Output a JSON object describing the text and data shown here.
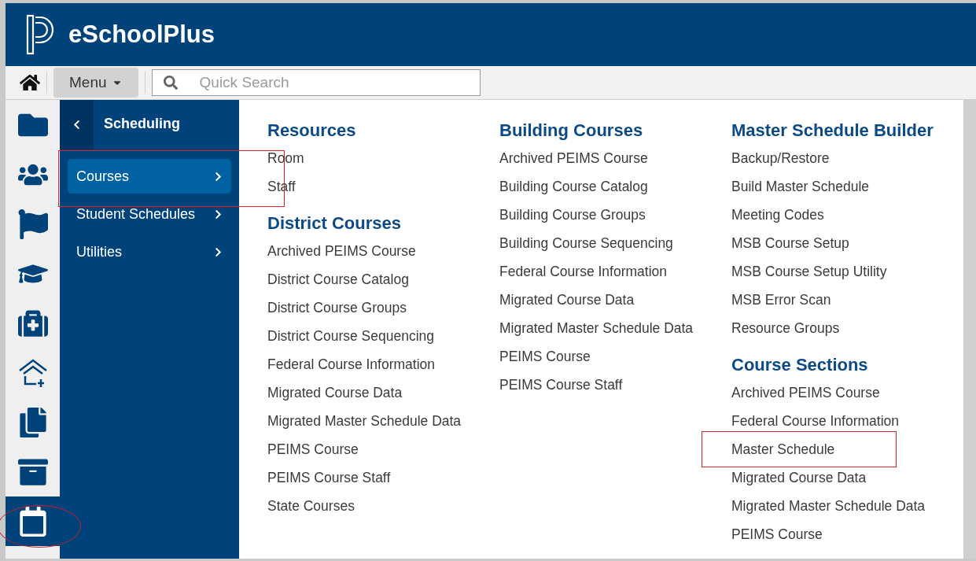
{
  "app": {
    "title": "eSchoolPlus"
  },
  "toolbar": {
    "menu_label": "Menu",
    "search": {
      "placeholder": "Quick Search"
    }
  },
  "rail": [
    {
      "kind": "folder",
      "selected": false,
      "annotated": false
    },
    {
      "kind": "users",
      "selected": false,
      "annotated": false
    },
    {
      "kind": "flag",
      "selected": false,
      "annotated": false
    },
    {
      "kind": "graduation",
      "selected": false,
      "annotated": false
    },
    {
      "kind": "medkit",
      "selected": false,
      "annotated": false
    },
    {
      "kind": "house",
      "selected": false,
      "annotated": false
    },
    {
      "kind": "copy",
      "selected": false,
      "annotated": false
    },
    {
      "kind": "archive",
      "selected": false,
      "annotated": false
    },
    {
      "kind": "calendar",
      "selected": true,
      "annotated": true
    }
  ],
  "submenu": {
    "title": "Scheduling",
    "items": [
      {
        "label": "Courses",
        "selected": true,
        "annotated": true
      },
      {
        "label": "Student Schedules",
        "selected": false,
        "annotated": false
      },
      {
        "label": "Utilities",
        "selected": false,
        "annotated": false
      }
    ]
  },
  "columns": [
    {
      "sections": [
        {
          "title": "Resources",
          "links": [
            {
              "label": "Room",
              "annotated": false
            },
            {
              "label": "Staff",
              "annotated": false
            }
          ]
        },
        {
          "title": "District Courses",
          "links": [
            {
              "label": "Archived PEIMS Course",
              "annotated": false
            },
            {
              "label": "District Course Catalog",
              "annotated": false
            },
            {
              "label": "District Course Groups",
              "annotated": false
            },
            {
              "label": "District Course Sequencing",
              "annotated": false
            },
            {
              "label": "Federal Course Information",
              "annotated": false
            },
            {
              "label": "Migrated Course Data",
              "annotated": false
            },
            {
              "label": "Migrated Master Schedule Data",
              "annotated": false
            },
            {
              "label": "PEIMS Course",
              "annotated": false
            },
            {
              "label": "PEIMS Course Staff",
              "annotated": false
            },
            {
              "label": "State Courses",
              "annotated": false
            }
          ]
        }
      ]
    },
    {
      "sections": [
        {
          "title": "Building Courses",
          "links": [
            {
              "label": "Archived PEIMS Course",
              "annotated": false
            },
            {
              "label": "Building Course Catalog",
              "annotated": false
            },
            {
              "label": "Building Course Groups",
              "annotated": false
            },
            {
              "label": "Building Course Sequencing",
              "annotated": false
            },
            {
              "label": "Federal Course Information",
              "annotated": false
            },
            {
              "label": "Migrated Course Data",
              "annotated": false
            },
            {
              "label": "Migrated Master Schedule Data",
              "annotated": false
            },
            {
              "label": "PEIMS Course",
              "annotated": false
            },
            {
              "label": "PEIMS Course Staff",
              "annotated": false
            }
          ]
        }
      ]
    },
    {
      "sections": [
        {
          "title": "Master Schedule Builder",
          "links": [
            {
              "label": "Backup/Restore",
              "annotated": false
            },
            {
              "label": "Build Master Schedule",
              "annotated": false
            },
            {
              "label": "Meeting Codes",
              "annotated": false
            },
            {
              "label": "MSB Course Setup",
              "annotated": false
            },
            {
              "label": "MSB Course Setup Utility",
              "annotated": false
            },
            {
              "label": "MSB Error Scan",
              "annotated": false
            },
            {
              "label": "Resource Groups",
              "annotated": false
            }
          ]
        },
        {
          "title": "Course Sections",
          "links": [
            {
              "label": "Archived PEIMS Course",
              "annotated": false
            },
            {
              "label": "Federal Course Information",
              "annotated": false
            },
            {
              "label": "Master Schedule",
              "annotated": true
            },
            {
              "label": "Migrated Course Data",
              "annotated": false
            },
            {
              "label": "Migrated Master Schedule Data",
              "annotated": false
            },
            {
              "label": "PEIMS Course",
              "annotated": false
            }
          ]
        }
      ]
    }
  ]
}
